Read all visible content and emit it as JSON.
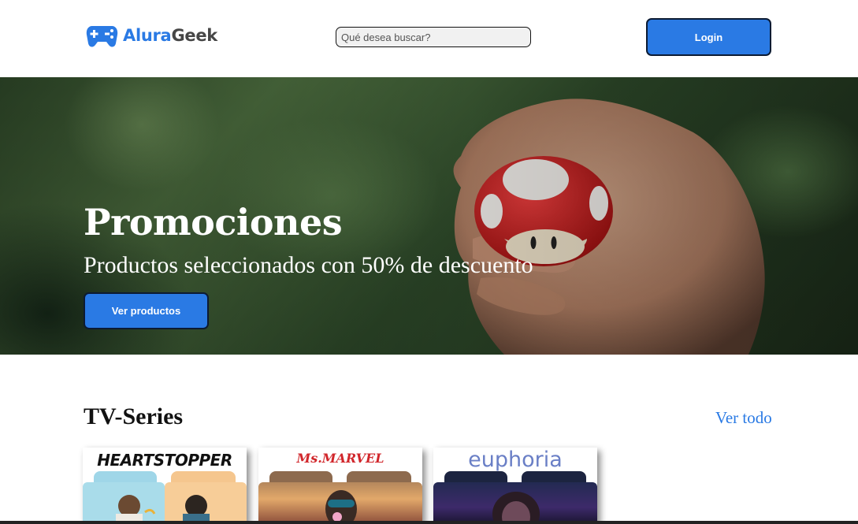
{
  "header": {
    "logo_part1": "Alura",
    "logo_part2": "Geek",
    "logo_icon": "gamepad-icon",
    "search_placeholder": "Qué desea buscar?",
    "login_label": "Login"
  },
  "hero": {
    "title": "Promociones",
    "subtitle": "Productos seleccionados con 50% de descuento",
    "button_label": "Ver productos"
  },
  "section": {
    "title": "TV-Series",
    "see_all": "Ver todo",
    "cards": [
      {
        "title": "HEARTSTOPPER"
      },
      {
        "title": "Ms.MARVEL"
      },
      {
        "title": "euphoria"
      }
    ]
  },
  "colors": {
    "accent": "#2a7ae4",
    "button_border": "#0c1b33",
    "logo_dark": "#464646"
  }
}
